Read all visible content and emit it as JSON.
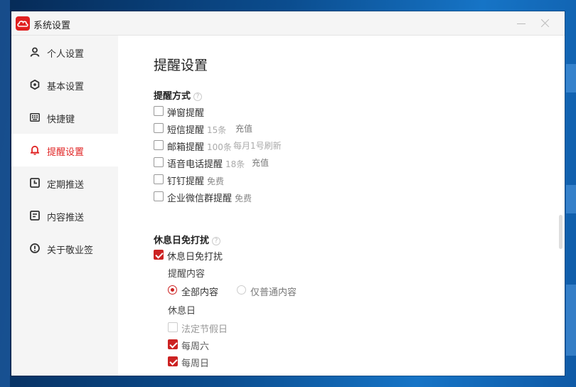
{
  "window": {
    "title": "系统设置"
  },
  "sidebar": {
    "items": [
      {
        "label": "个人设置",
        "icon": "user-icon",
        "active": false
      },
      {
        "label": "基本设置",
        "icon": "gear-icon",
        "active": false
      },
      {
        "label": "快捷键",
        "icon": "keyboard-icon",
        "active": false
      },
      {
        "label": "提醒设置",
        "icon": "bell-icon",
        "active": true
      },
      {
        "label": "定期推送",
        "icon": "clock-icon",
        "active": false
      },
      {
        "label": "内容推送",
        "icon": "document-icon",
        "active": false
      },
      {
        "label": "关于敬业签",
        "icon": "info-icon",
        "active": false
      }
    ]
  },
  "main": {
    "title": "提醒设置",
    "reminder_methods": {
      "title": "提醒方式",
      "help_icon": "question-icon",
      "options": [
        {
          "label": "弹窗提醒",
          "checked": false
        },
        {
          "label": "短信提醒",
          "note": "15条",
          "link": "充值",
          "checked": false
        },
        {
          "label": "邮箱提醒",
          "note": "100条",
          "note2": "每月1号刷新",
          "checked": false
        },
        {
          "label": "语音电话提醒",
          "note": "18条",
          "link": "充值",
          "checked": false
        },
        {
          "label": "钉钉提醒",
          "note": "免费",
          "checked": false
        },
        {
          "label": "企业微信群提醒",
          "note": "免费",
          "checked": false
        }
      ]
    },
    "dnd": {
      "title": "休息日免打扰",
      "help_icon": "question-icon",
      "toggle": {
        "label": "休息日免打扰",
        "checked": true
      },
      "content_label": "提醒内容",
      "radios": [
        {
          "label": "全部内容",
          "checked": true
        },
        {
          "label": "仅普通内容",
          "checked": false
        }
      ],
      "rest_days_label": "休息日",
      "rest_days": [
        {
          "label": "法定节假日",
          "checked": false
        },
        {
          "label": "每周六",
          "checked": true
        },
        {
          "label": "每周日",
          "checked": true
        }
      ]
    }
  },
  "colors": {
    "accent": "#cc2222",
    "active_text": "#e02525",
    "sidebar_bg": "#f5f5f5",
    "desktop": "#0b4d8f"
  }
}
